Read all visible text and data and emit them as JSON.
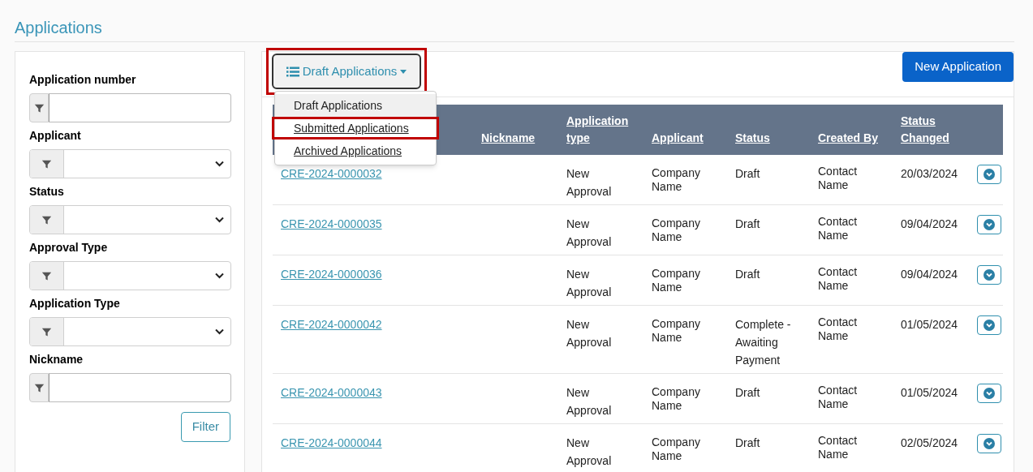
{
  "page_title": "Applications",
  "filters": [
    {
      "kind": "text",
      "label": "Application number"
    },
    {
      "kind": "select",
      "label": "Applicant"
    },
    {
      "kind": "select",
      "label": "Status"
    },
    {
      "kind": "select",
      "label": "Approval Type"
    },
    {
      "kind": "select",
      "label": "Application Type"
    },
    {
      "kind": "text",
      "label": "Nickname"
    }
  ],
  "filter_button": "Filter",
  "view_dropdown": {
    "label": "Draft Applications",
    "highlighted": true,
    "expanded": true,
    "items": [
      {
        "label": "Draft Applications",
        "selected": true,
        "highlighted": false
      },
      {
        "label": "Submitted Applications",
        "selected": false,
        "highlighted": true
      },
      {
        "label": "Archived Applications",
        "selected": false,
        "highlighted": false
      }
    ]
  },
  "new_button": "New Application",
  "table": {
    "columns": [
      "Nickname",
      "Application type",
      "Applicant",
      "Status",
      "Created By",
      "Status Changed"
    ],
    "rows": [
      {
        "number": "CRE-2024-0000032",
        "type": "New Approval",
        "applicant": "Company Name",
        "status": "Draft",
        "created_by": "Contact Name",
        "changed": "20/03/2024"
      },
      {
        "number": "CRE-2024-0000035",
        "type": "New Approval",
        "applicant": "Company Name",
        "status": "Draft",
        "created_by": "Contact Name",
        "changed": "09/04/2024"
      },
      {
        "number": "CRE-2024-0000036",
        "type": "New Approval",
        "applicant": "Company Name",
        "status": "Draft",
        "created_by": "Contact Name",
        "changed": "09/04/2024"
      },
      {
        "number": "CRE-2024-0000042",
        "type": "New Approval",
        "applicant": "Company Name",
        "status": "Complete - Awaiting Payment",
        "created_by": "Contact Name",
        "changed": "01/05/2024"
      },
      {
        "number": "CRE-2024-0000043",
        "type": "New Approval",
        "applicant": "Company Name",
        "status": "Draft",
        "created_by": "Contact Name",
        "changed": "01/05/2024"
      },
      {
        "number": "CRE-2024-0000044",
        "type": "New Approval",
        "applicant": "Company Name",
        "status": "Draft",
        "created_by": "Contact Name",
        "changed": "02/05/2024"
      }
    ]
  }
}
